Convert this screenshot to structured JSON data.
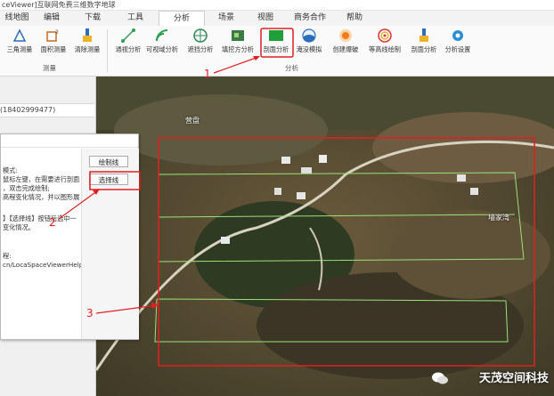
{
  "app": {
    "title": "ceViewer]互联网免费三维数字地球"
  },
  "menu": {
    "items": [
      "线地图",
      "编辑",
      "下载",
      "工具",
      "分析",
      "场景",
      "视图",
      "商务合作",
      "帮助"
    ],
    "active_index": 4
  },
  "ribbon": {
    "measure_buttons": [
      "三角测量",
      "面积测量",
      "清除测量"
    ],
    "measure_group_label": "测量",
    "analysis_buttons": [
      "通视分析",
      "可视域分析",
      "遮挡分析",
      "填挖方分析",
      "剖面分析",
      "淹没模拟",
      "创建爆破",
      "等高线绘制",
      "剖面分析",
      "分析设置"
    ],
    "analysis_group_label": "分析"
  },
  "left_panel": {
    "phone": "(18402999477)"
  },
  "dialog": {
    "lines": [
      "模式:",
      "鼠标左键，在需要进行剖面",
      "，双击完成绘制;",
      "高程变化情况，并以图形展",
      "】【选择线】按钮后选中一",
      "变化情况。",
      "程:",
      "cn/LocaSpaceViewerHelp/"
    ],
    "draw_line_label": "绘制线",
    "select_line_label": "选择线"
  },
  "map": {
    "places": [
      "营盘",
      "墙家湾"
    ]
  },
  "annotations": {
    "a1": "1",
    "a2": "2",
    "a3": "3"
  },
  "watermark": "天茂空间科技",
  "colors": {
    "highlight": "#e02020",
    "profile_line": "#9be27a"
  }
}
